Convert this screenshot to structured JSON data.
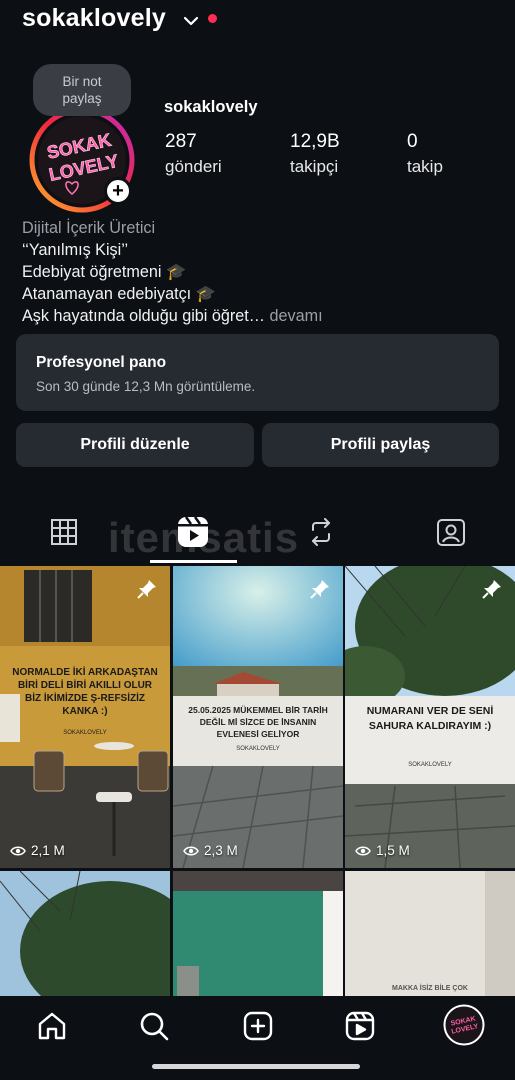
{
  "header": {
    "username": "sokaklovely",
    "dropdown_icon": "chevron-down-icon",
    "notification_dot_color": "#ff2d55"
  },
  "note": {
    "text_line1": "Bir not",
    "text_line2": "paylaş"
  },
  "avatar": {
    "text_line1": "SOKAK",
    "text_line2": "LOVELY",
    "add_icon": "plus-icon"
  },
  "profile": {
    "name": "sokaklovely",
    "stats": [
      {
        "value": "287",
        "label": "gönderi"
      },
      {
        "value": "12,9B",
        "label": "takipçi"
      },
      {
        "value": "0",
        "label": "takip"
      }
    ]
  },
  "bio": {
    "category": "Dijital İçerik Üretici",
    "lines": [
      "‘‘Yanılmış Kişi’’",
      "Edebiyat öğretmeni 🎓",
      "Atanamayan edebiyatçı 🎓",
      "Aşk hayatında olduğu gibi öğret…"
    ],
    "more": "devamı"
  },
  "pro_panel": {
    "title": "Profesyonel pano",
    "subtitle": "Son 30 günde 12,3 Mn görüntüleme."
  },
  "buttons": {
    "edit_profile": "Profili düzenle",
    "share_profile": "Profili paylaş"
  },
  "tabs": [
    "grid-icon",
    "reels-icon",
    "reposts-icon",
    "tagged-icon"
  ],
  "active_tab": "reels-icon",
  "watermark": "itemsatis",
  "grid": {
    "tiles": [
      {
        "caption": "NORMALDE İKİ ARKADAŞTAN BİRİ DELİ BİRİ AKILLI OLUR BİZ İKİMİZDE Ş-REFSİZİZ KANKA :)",
        "signature": "SOKAKLOVELY",
        "views": "2,1 M",
        "pinned": true
      },
      {
        "caption": "25.05.2025 MÜKEMMEL BİR TARİH DEĞİL Mİ SİZCE DE İNSANIN EVLENESİ GELİYOR",
        "signature": "SOKAKLOVELY",
        "views": "2,3 M",
        "pinned": true
      },
      {
        "caption": "NUMARANI VER DE SENİ SAHURA KALDIRAYIM :)",
        "signature": "SOKAKLOVELY",
        "views": "1,5 M",
        "pinned": true
      },
      {
        "caption": "",
        "views": "",
        "pinned": false
      },
      {
        "caption": "",
        "views": "",
        "pinned": false
      },
      {
        "caption": "MAKKA İSİZ BİLE ÇOK",
        "views": "",
        "pinned": false
      }
    ]
  },
  "bottom_nav": [
    "home-icon",
    "search-icon",
    "create-icon",
    "reels-nav-icon",
    "profile-avatar"
  ]
}
